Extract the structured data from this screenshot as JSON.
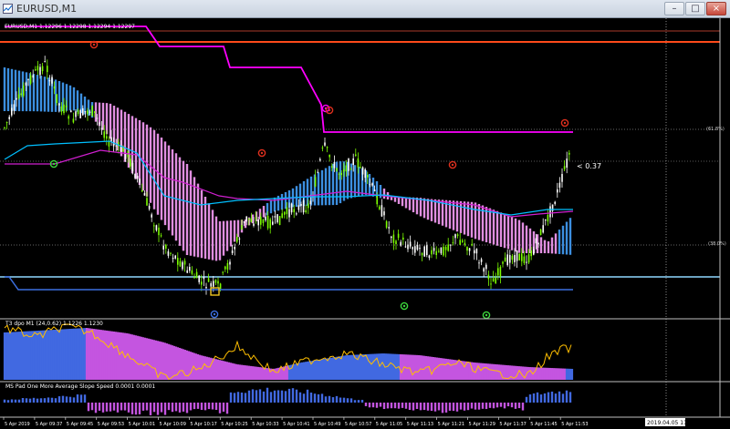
{
  "window": {
    "title": "EURUSD,M1",
    "min": "–",
    "max": "□",
    "close": "×"
  },
  "main_header": "EURUSD,M1  1.12296 1.12298 1.12294 1.12297",
  "fib_labels": {
    "top": "(61.8%)",
    "mid": "(38.0%)"
  },
  "cursor_text": "< 0.37",
  "ind1_header": "T3 dpo M1 (24,0.62) 1.1226 1.1230",
  "ind2_header": "MS Pad One More Average Slope Speed 0.0001 0.0001",
  "time_labels": [
    "5 Apr 2019",
    "5 Apr 09:37",
    "5 Apr 09:45",
    "5 Apr 09:53",
    "5 Apr 10:01",
    "5 Apr 10:09",
    "5 Apr 10:17",
    "5 Apr 10:25",
    "5 Apr 10:33",
    "5 Apr 10:41",
    "5 Apr 10:49",
    "5 Apr 10:57",
    "5 Apr 11:05",
    "5 Apr 11:13",
    "5 Apr 11:21",
    "5 Apr 11:29",
    "5 Apr 11:37",
    "5 Apr 11:45",
    "5 Apr 11:53"
  ],
  "current_time_label": "2019.04.05 11:59",
  "colors": {
    "bull": "#ffffff",
    "bear": "#7CFC00",
    "blue_hist": "#3c8fe0",
    "pink_hist": "#e08ee0",
    "magenta": "#ff00ff",
    "red_line": "#ff4a1a",
    "cyan": "#00bfff",
    "ind_blue": "#4169e1",
    "ind_violet": "#c455e0",
    "ind_yellow": "#ffbf00",
    "frame": "#c0c0c0"
  },
  "icons": {
    "app": "chart-window-icon",
    "marker": "signal-circle-icon"
  }
}
